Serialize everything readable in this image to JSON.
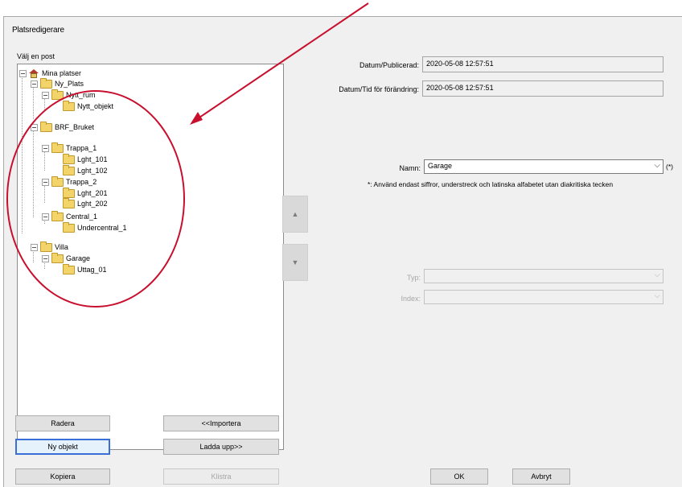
{
  "window": {
    "title": "Platsredigerare"
  },
  "tree": {
    "label": "Välj en post",
    "nodes": [
      {
        "label": "Mina platser"
      },
      {
        "label": "Ny_Plats"
      },
      {
        "label": "Nytt_rum"
      },
      {
        "label": "Nytt_objekt"
      },
      {
        "label": "BRF_Bruket"
      },
      {
        "label": "Trappa_1"
      },
      {
        "label": "Lght_101"
      },
      {
        "label": "Lght_102"
      },
      {
        "label": "Trappa_2"
      },
      {
        "label": "Lght_201"
      },
      {
        "label": "Lght_202"
      },
      {
        "label": "Central_1"
      },
      {
        "label": "Undercentral_1"
      },
      {
        "label": "Villa"
      },
      {
        "label": "Garage"
      },
      {
        "label": "Uttag_01"
      }
    ]
  },
  "fields": {
    "published_label": "Datum/Publicerad:",
    "published_value": "2020-05-08 12:57:51",
    "modified_label": "Datum/Tid för förändring:",
    "modified_value": "2020-05-08 12:57:51",
    "name_label": "Namn:",
    "name_value": "Garage",
    "name_required": "(*)",
    "name_hint": "*: Använd endast siffror, understreck och latinska alfabetet utan diakritiska tecken",
    "type_label": "Typ:",
    "type_value": "",
    "index_label": "Index:",
    "index_value": ""
  },
  "arrows": {
    "up": "▲",
    "down": "▼"
  },
  "buttons": {
    "delete": "Radera",
    "import": "<<Importera",
    "new_object": "Ny objekt",
    "upload": "Ladda upp>>",
    "copy": "Kopiera",
    "paste": "Klistra",
    "ok": "OK",
    "cancel": "Avbryt"
  },
  "annotation_color": "#c8102e"
}
